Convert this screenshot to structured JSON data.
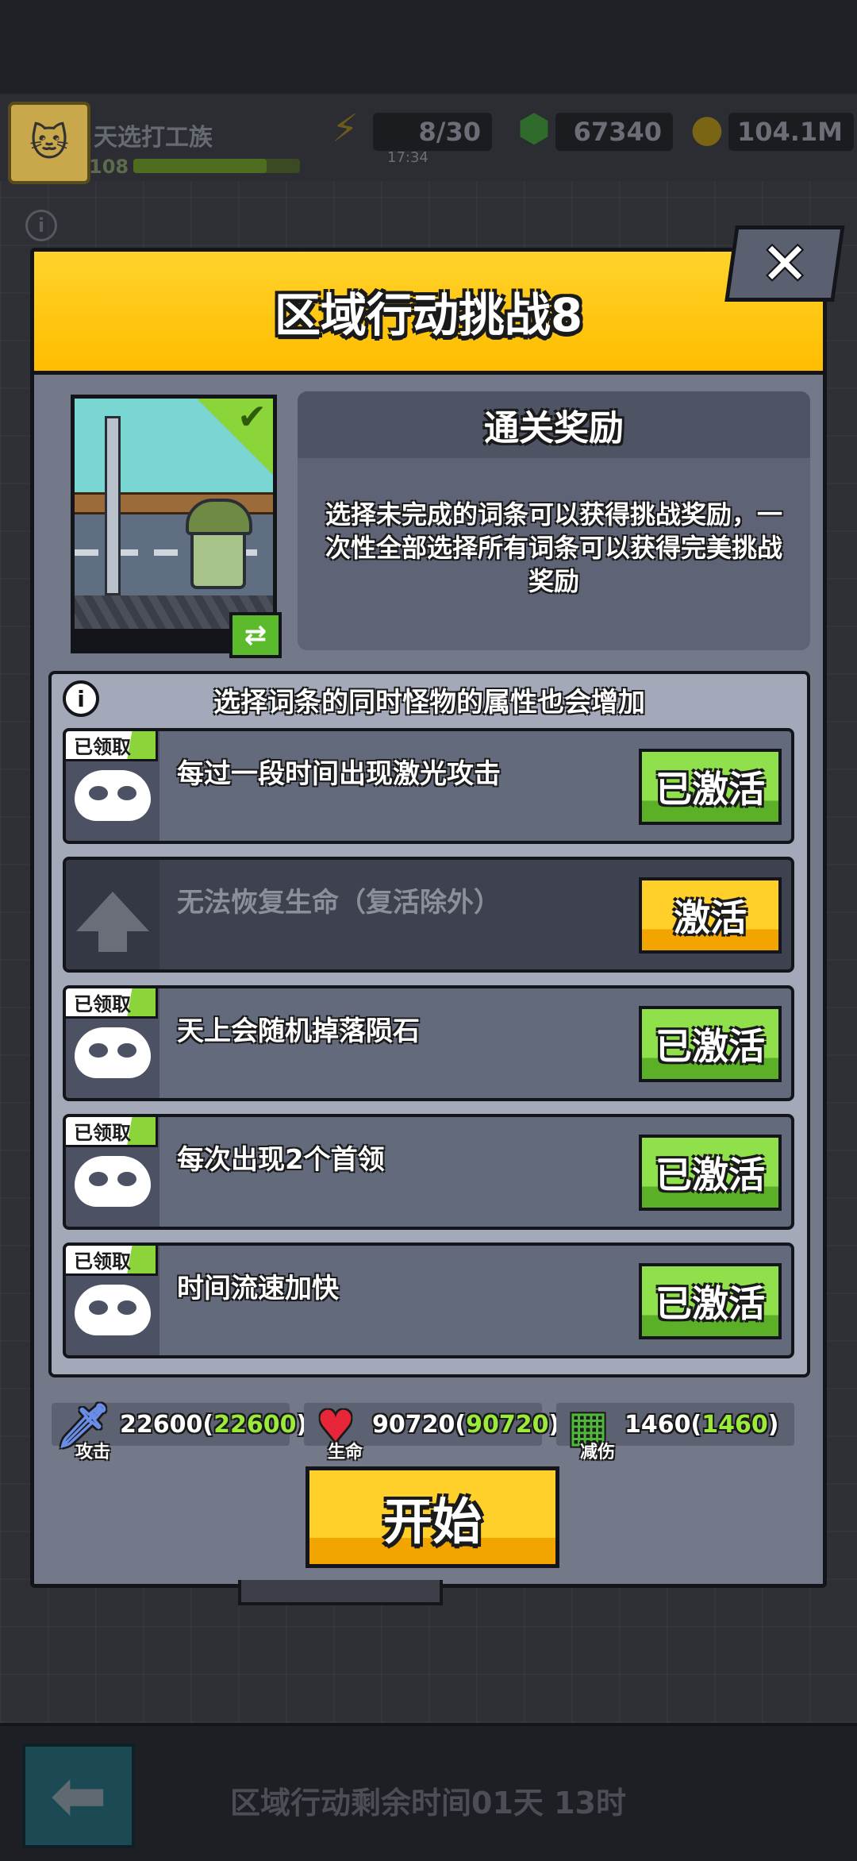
{
  "player": {
    "name": "天选打工族",
    "level": "108",
    "xp_fraction": 0.8
  },
  "resources": {
    "energy": "8/30",
    "energy_timer": "17:34",
    "gems": "67340",
    "coins": "104.1M"
  },
  "modal": {
    "title": "区域行动挑战8",
    "close_label": "✕",
    "reward": {
      "title": "通关奖励",
      "description": "选择未完成的词条可以获得挑战奖励，一次性全部选择所有词条可以获得完美挑战奖励"
    },
    "warning": "选择词条的同时怪物的属性也会增加",
    "claimed_tag": "已领取",
    "items": [
      {
        "text": "每过一段时间出现激光攻击",
        "button": "已激活",
        "claimed": true
      },
      {
        "text": "无法恢复生命（复活除外）",
        "button": "激活",
        "claimed": false
      },
      {
        "text": "天上会随机掉落陨石",
        "button": "已激活",
        "claimed": true
      },
      {
        "text": "每次出现2个首领",
        "button": "已激活",
        "claimed": true
      },
      {
        "text": "时间流速加快",
        "button": "已激活",
        "claimed": true
      }
    ],
    "stats": {
      "attack": {
        "label": "攻击",
        "value": "22600",
        "bonus": "22600"
      },
      "hp": {
        "label": "生命",
        "value": "90720",
        "bonus": "90720"
      },
      "defense": {
        "label": "减伤",
        "value": "1460",
        "bonus": "1460"
      }
    },
    "start_button": "开始"
  },
  "footer": {
    "remaining": "区域行动剩余时间01天 13时"
  },
  "colors": {
    "accent_yellow": "#ffc100",
    "active_green": "#8fe04a",
    "panel": "#737989"
  }
}
